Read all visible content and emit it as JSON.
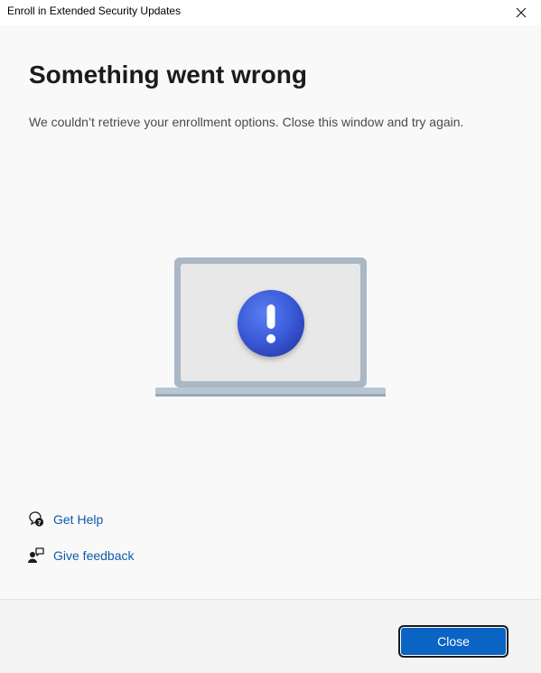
{
  "window": {
    "title": "Enroll in Extended Security Updates",
    "close_icon": "close-icon"
  },
  "main": {
    "heading": "Something went wrong",
    "message": "We couldn’t retrieve your enrollment options. Close this window and try again.",
    "illustration": {
      "name": "laptop-alert-illustration",
      "alert_color": "#3558d6"
    }
  },
  "links": {
    "help_label": "Get Help",
    "help_icon": "help-chat-icon",
    "feedback_label": "Give feedback",
    "feedback_icon": "feedback-person-icon",
    "link_color": "#0f5aa8"
  },
  "footer": {
    "close_label": "Close",
    "accent": "#0b63c4"
  }
}
